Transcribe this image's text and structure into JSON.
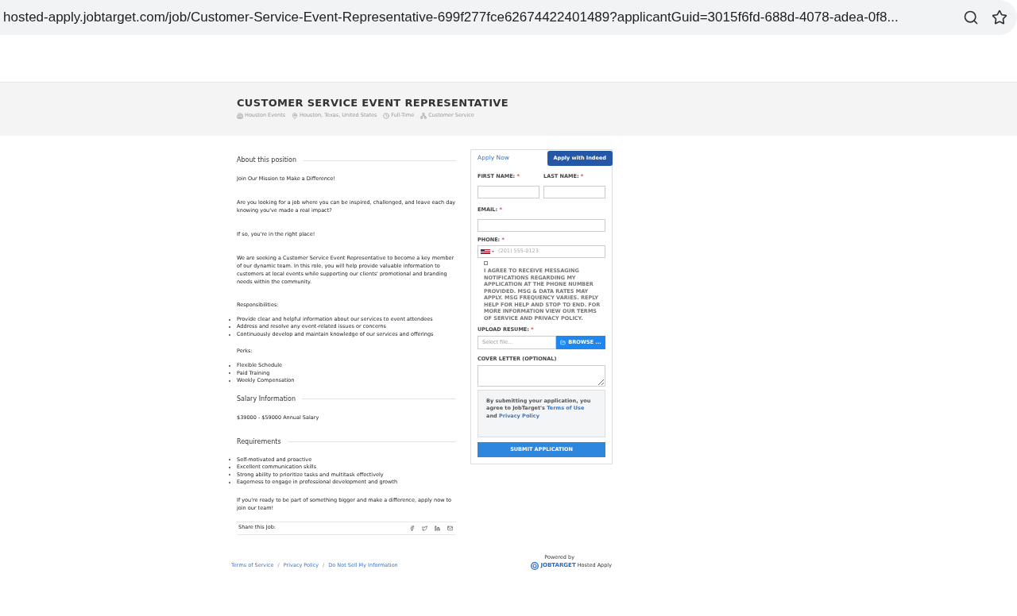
{
  "browser": {
    "url": "hosted-apply.jobtarget.com/job/Customer-Service-Event-Representative-699f277fce62674422401489?applicantGuid=3015f6fd-688d-4078-adea-0f8..."
  },
  "job": {
    "title": "CUSTOMER SERVICE EVENT REPRESENTATIVE",
    "meta": [
      {
        "kind": "company",
        "text": "Houston Events"
      },
      {
        "kind": "location",
        "text": "Houston, Texas, United States"
      },
      {
        "kind": "time",
        "text": "Full-Time"
      },
      {
        "kind": "category",
        "text": "Customer Service"
      }
    ]
  },
  "description": [
    {
      "kind": "heading",
      "text": "About this position"
    },
    {
      "kind": "para",
      "text": "Join Our Mission to Make a Difference!"
    },
    {
      "kind": "para",
      "text": "Are you looking for a job where you can be inspired, challenged, and leave each day knowing you've made a real impact?"
    },
    {
      "kind": "para",
      "text": "If so, you're in the right place!"
    },
    {
      "kind": "para",
      "text": "We are seeking a Customer Service Event Representative to become a key member of our dynamic team. In this role, you will help provide valuable information to customers at local events while supporting our clients' promotional and branding needs within the community."
    },
    {
      "kind": "label",
      "text": "Responsibilities:"
    },
    {
      "kind": "list",
      "items": [
        "Provide clear and helpful information about our services to event attendees",
        "Address and resolve any event-related issues or concerns",
        "Continuously develop and maintain knowledge of our services and offerings"
      ]
    },
    {
      "kind": "label",
      "text": "Perks:"
    },
    {
      "kind": "list",
      "items": [
        "Flexible Schedule",
        "Paid Training",
        "Weekly Compensation"
      ]
    },
    {
      "kind": "heading",
      "text": "Salary Information"
    },
    {
      "kind": "para",
      "text": "$39000 - $59000 Annual Salary"
    },
    {
      "kind": "heading",
      "text": "Requirements"
    },
    {
      "kind": "list",
      "items": [
        "Self-motivated and proactive",
        "Excellent communication skills",
        "Strong ability to prioritize tasks and multitask effectively",
        "Eagerness to engage in professional development and growth"
      ]
    },
    {
      "kind": "para",
      "text": "If you're ready to be part of something bigger and make a difference, apply now to join our team!"
    }
  ],
  "share": {
    "label": "Share this Job:"
  },
  "form": {
    "apply_now": "Apply Now",
    "indeed_button": "Apply with Indeed",
    "first_name": "FIRST NAME:",
    "last_name": "LAST NAME:",
    "email": "EMAIL:",
    "phone": "PHONE:",
    "phone_placeholder": "(201) 555-0123",
    "required_mark": "*",
    "consent": {
      "checked": false,
      "text": "I AGREE TO RECEIVE MESSAGING NOTIFICATIONS REGARDING MY APPLICATION AT THE PHONE NUMBER PROVIDED. MSG & DATA RATES MAY APPLY. MSG FREQUENCY VARIES. REPLY HELP FOR HELP AND STOP TO END. FOR MORE INFORMATION VIEW OUR TERMS OF SERVICE AND PRIVACY POLICY."
    },
    "upload": "UPLOAD RESUME:",
    "file_placeholder": "Select file...",
    "browse": "BROWSE ...",
    "cover": "COVER LETTER (OPTIONAL)",
    "notice": {
      "text": "By submitting your application, you agree to JobTarget's",
      "terms": "Terms of Use",
      "and": "and",
      "privacy": "Privacy Policy"
    },
    "submit": "SUBMIT APPLICATION"
  },
  "footer": {
    "links": [
      "Terms of Service",
      "Privacy Policy",
      "Do Not Sell My Information"
    ],
    "separator": "/",
    "powered": "Powered by",
    "brand": "JOBTARGET",
    "product": "Hosted Apply"
  }
}
